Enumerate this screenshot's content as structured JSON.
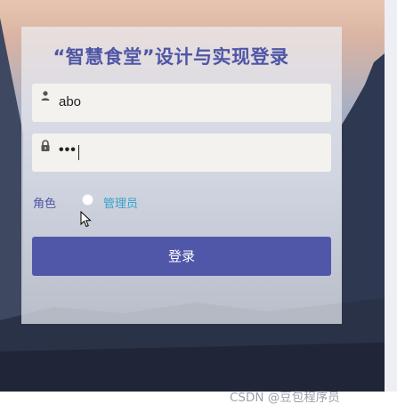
{
  "page": {
    "title": "“智慧食堂”设计与实现登录"
  },
  "form": {
    "username_value": "abo",
    "password_masked": "•••",
    "role_label": "角色",
    "role_option": "管理员",
    "role_option_selected": false,
    "submit_label": "登录"
  },
  "icons": {
    "username": "user-icon",
    "password": "lock-icon",
    "pointer": "mouse-cursor-icon"
  },
  "colors": {
    "accent": "#5057a9",
    "title": "#4f56a6",
    "role_option_text": "#35a2cc"
  },
  "watermark": "CSDN @豆包程序员"
}
